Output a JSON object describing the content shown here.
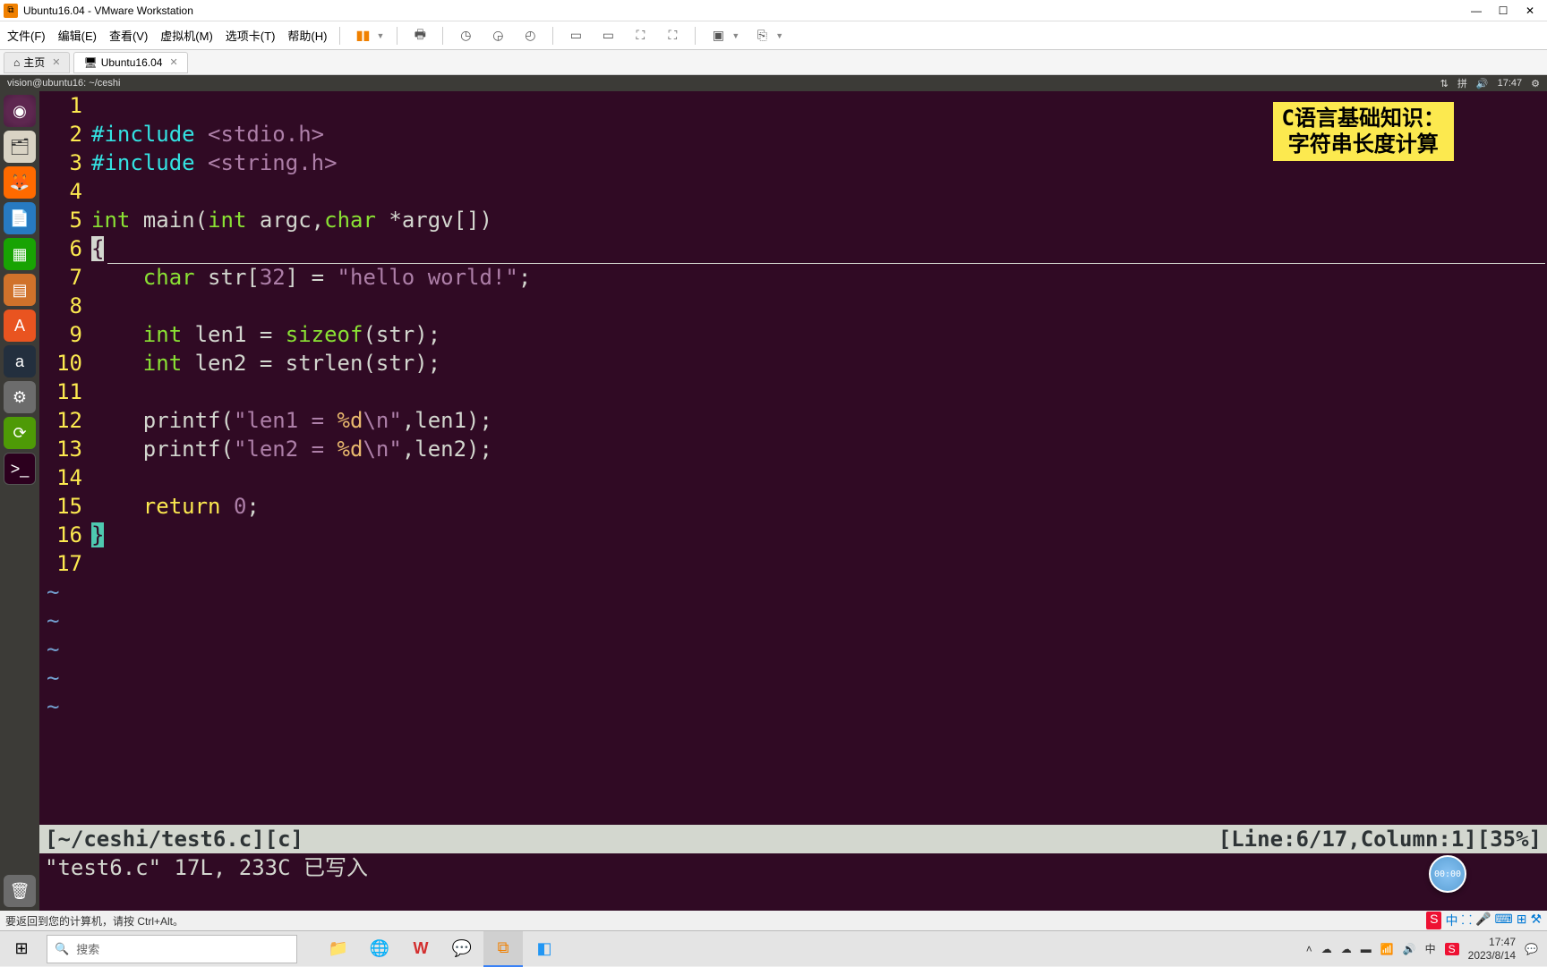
{
  "vmware": {
    "title": "Ubuntu16.04 - VMware Workstation",
    "menu": {
      "file": "文件(F)",
      "edit": "编辑(E)",
      "view": "查看(V)",
      "vm": "虚拟机(M)",
      "tabs": "选项卡(T)",
      "help": "帮助(H)"
    },
    "tabs": {
      "home": "主页",
      "vm": "Ubuntu16.04"
    },
    "hint": "要返回到您的计算机，请按 Ctrl+Alt。"
  },
  "ubuntu": {
    "topbar_title": "vision@ubuntu16: ~/ceshi",
    "time": "17:47"
  },
  "badge": {
    "line1": "C语言基础知识：",
    "line2": "字符串长度计算"
  },
  "timer": "00:00",
  "vim": {
    "status_path": "[~/ceshi/test6.c][c]",
    "status_pos": "[Line:6/17,Column:1][35%]",
    "status_msg": "\"test6.c\" 17L, 233C 已写入",
    "code": {
      "l1": "",
      "l2_a": "#include ",
      "l2_b": "<stdio.h>",
      "l3_a": "#include ",
      "l3_b": "<string.h>",
      "l4": "",
      "l5_a": "int",
      "l5_b": " main(",
      "l5_c": "int",
      "l5_d": " argc,",
      "l5_e": "char",
      "l5_f": " *argv[])",
      "l6": "{",
      "l7_a": "    ",
      "l7_b": "char",
      "l7_c": " str[",
      "l7_d": "32",
      "l7_e": "] = ",
      "l7_f": "\"hello world!\"",
      "l7_g": ";",
      "l8": "",
      "l9_a": "    ",
      "l9_b": "int",
      "l9_c": " len1 = ",
      "l9_d": "sizeof",
      "l9_e": "(str);",
      "l10_a": "    ",
      "l10_b": "int",
      "l10_c": " len2 = strlen(str);",
      "l11": "",
      "l12_a": "    printf(",
      "l12_b": "\"len1 = ",
      "l12_c": "%d",
      "l12_d": "\\n",
      "l12_e": "\"",
      "l12_f": ",len1);",
      "l13_a": "    printf(",
      "l13_b": "\"len2 = ",
      "l13_c": "%d",
      "l13_d": "\\n",
      "l13_e": "\"",
      "l13_f": ",len2);",
      "l14": "",
      "l15_a": "    ",
      "l15_b": "return",
      "l15_c": " ",
      "l15_d": "0",
      "l15_e": ";",
      "l16": "}",
      "l17": ""
    }
  },
  "lineno": {
    "1": "1",
    "2": "2",
    "3": "3",
    "4": "4",
    "5": "5",
    "6": "6",
    "7": "7",
    "8": "8",
    "9": "9",
    "10": "10",
    "11": "11",
    "12": "12",
    "13": "13",
    "14": "14",
    "15": "15",
    "16": "16",
    "17": "17"
  },
  "windows": {
    "search_placeholder": "搜索",
    "time": "17:47",
    "date": "2023/8/14",
    "ime": "中"
  }
}
